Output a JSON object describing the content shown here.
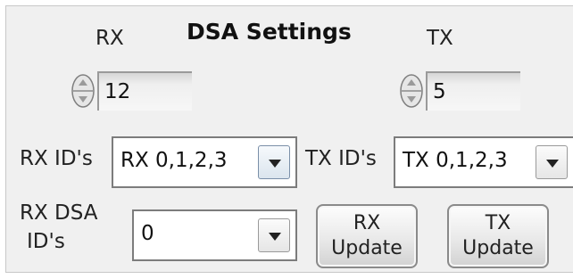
{
  "panel": {
    "title": "DSA Settings"
  },
  "rx": {
    "label": "RX",
    "value": "12"
  },
  "tx": {
    "label": "TX",
    "value": "5"
  },
  "rx_ids": {
    "label": "RX ID's",
    "selected": "RX 0,1,2,3"
  },
  "tx_ids": {
    "label": "TX ID's",
    "selected": "TX 0,1,2,3"
  },
  "rx_dsa_ids": {
    "label_line1": "RX DSA",
    "label_line2": "ID's",
    "selected": "0"
  },
  "buttons": {
    "rx_update": {
      "line1": "RX",
      "line2": "Update"
    },
    "tx_update": {
      "line1": "TX",
      "line2": "Update"
    }
  },
  "icons": {
    "spinner": "up-down-spinner-icon",
    "dropdown": "chevron-down-icon"
  }
}
